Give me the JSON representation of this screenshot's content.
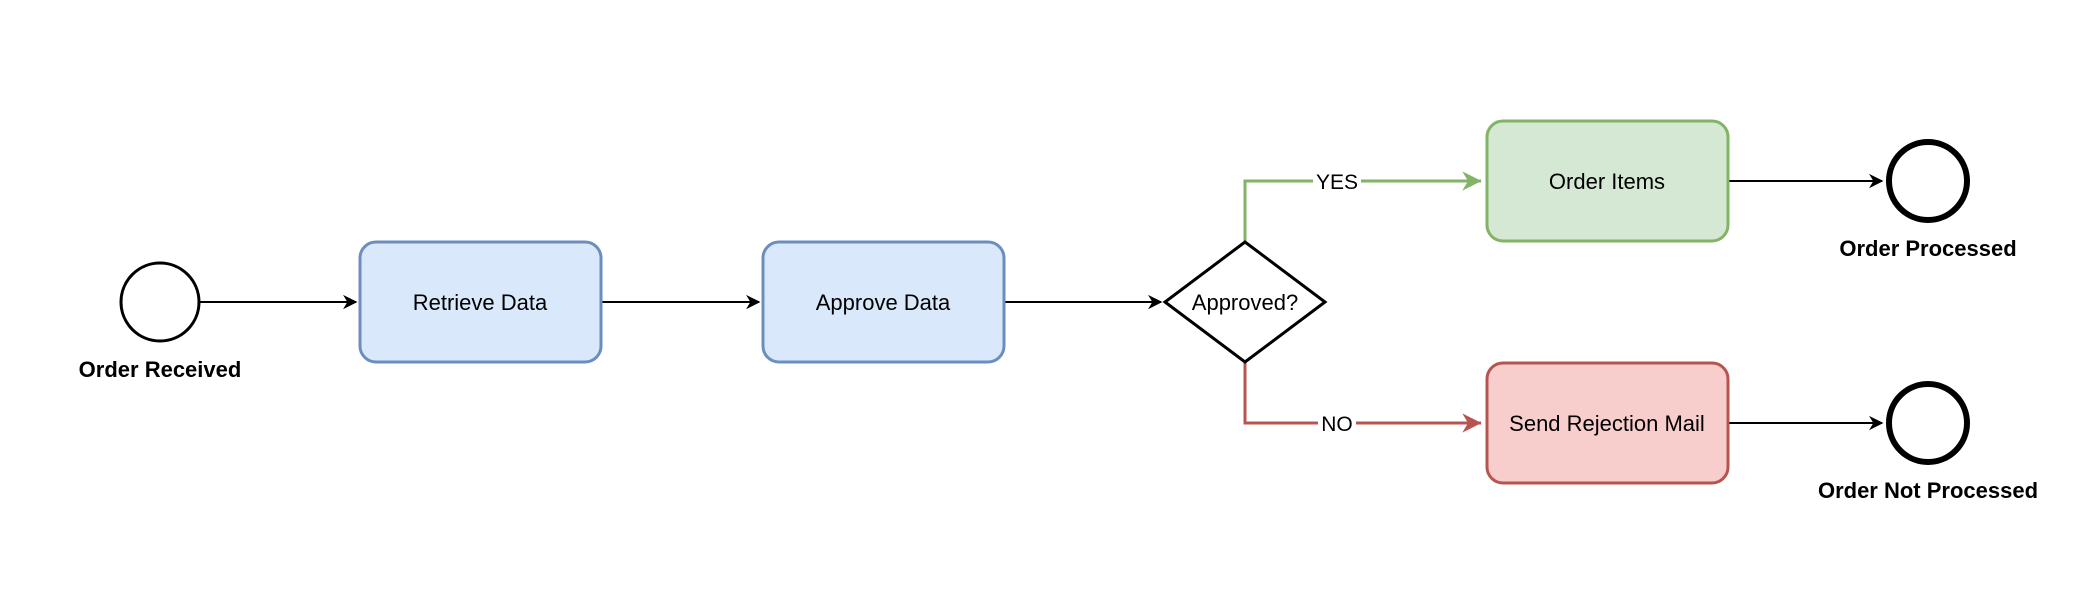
{
  "diagram": {
    "type": "bpmn-flowchart",
    "colors": {
      "task_fill": "#dae8fc",
      "task_stroke": "#6c8ebf",
      "yes_fill": "#d5e8d4",
      "yes_stroke": "#82b366",
      "no_fill": "#f8cecc",
      "no_stroke": "#b85450",
      "line": "#000000"
    },
    "nodes": {
      "start": {
        "kind": "start-event",
        "label": "Order Received"
      },
      "retrieve": {
        "kind": "task",
        "label": "Retrieve Data"
      },
      "approve": {
        "kind": "task",
        "label": "Approve Data"
      },
      "gateway": {
        "kind": "exclusive-gateway",
        "label": "Approved?"
      },
      "order_items": {
        "kind": "task",
        "label": "Order Items"
      },
      "reject": {
        "kind": "task",
        "label": "Send Rejection Mail"
      },
      "end_ok": {
        "kind": "end-event",
        "label": "Order Processed"
      },
      "end_fail": {
        "kind": "end-event",
        "label": "Order Not Processed"
      }
    },
    "edges": [
      {
        "from": "start",
        "to": "retrieve",
        "label": ""
      },
      {
        "from": "retrieve",
        "to": "approve",
        "label": ""
      },
      {
        "from": "approve",
        "to": "gateway",
        "label": ""
      },
      {
        "from": "gateway",
        "to": "order_items",
        "label": "YES"
      },
      {
        "from": "gateway",
        "to": "reject",
        "label": "NO"
      },
      {
        "from": "order_items",
        "to": "end_ok",
        "label": ""
      },
      {
        "from": "reject",
        "to": "end_fail",
        "label": ""
      }
    ]
  }
}
